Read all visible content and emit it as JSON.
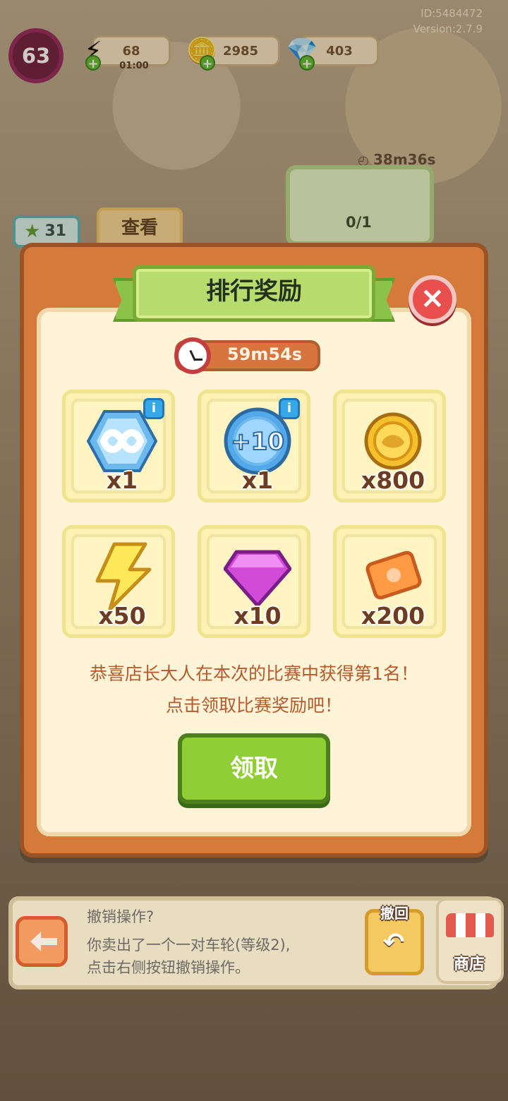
{
  "meta": {
    "user_id": "ID:5484472",
    "version": "Version:2.7.9"
  },
  "player": {
    "level": "63"
  },
  "resources": {
    "energy_value": "68",
    "energy_timer": "01:00",
    "coins_value": "2985",
    "gems_value": "403"
  },
  "shop": {
    "stars_value": "31",
    "view_button": "查看",
    "task_timer": "38m36s",
    "task_progress": "0/1"
  },
  "dialog": {
    "title": "排行奖励",
    "timer": "59m54s",
    "rewards": [
      {
        "icon": "infinity-icon",
        "qty": "x1",
        "has_info": true
      },
      {
        "icon": "plus10-icon",
        "qty": "x1",
        "has_info": true
      },
      {
        "icon": "coin-icon",
        "qty": "x800",
        "has_info": false
      },
      {
        "icon": "lightning-icon",
        "qty": "x50",
        "has_info": false
      },
      {
        "icon": "gem-icon",
        "qty": "x10",
        "has_info": false
      },
      {
        "icon": "ticket-icon",
        "qty": "x200",
        "has_info": false
      }
    ],
    "message_line1": "恭喜店长大人在本次的比赛中获得第1名！",
    "message_line2": "点击领取比赛奖励吧！",
    "claim_button": "领取"
  },
  "bottom": {
    "hint_title": "撤销操作?",
    "hint_line1": "你卖出了一个一对车轮(等级2),",
    "hint_line2": "点击右侧按钮撤销操作。",
    "undo_label": "撤回",
    "shop_label": "商店"
  },
  "colors": {
    "dialog_orange": "#d47a3a",
    "ribbon_green": "#b8db6e",
    "claim_green": "#8fce35",
    "close_red": "#e9504d",
    "text_brown": "#b65a2c"
  }
}
